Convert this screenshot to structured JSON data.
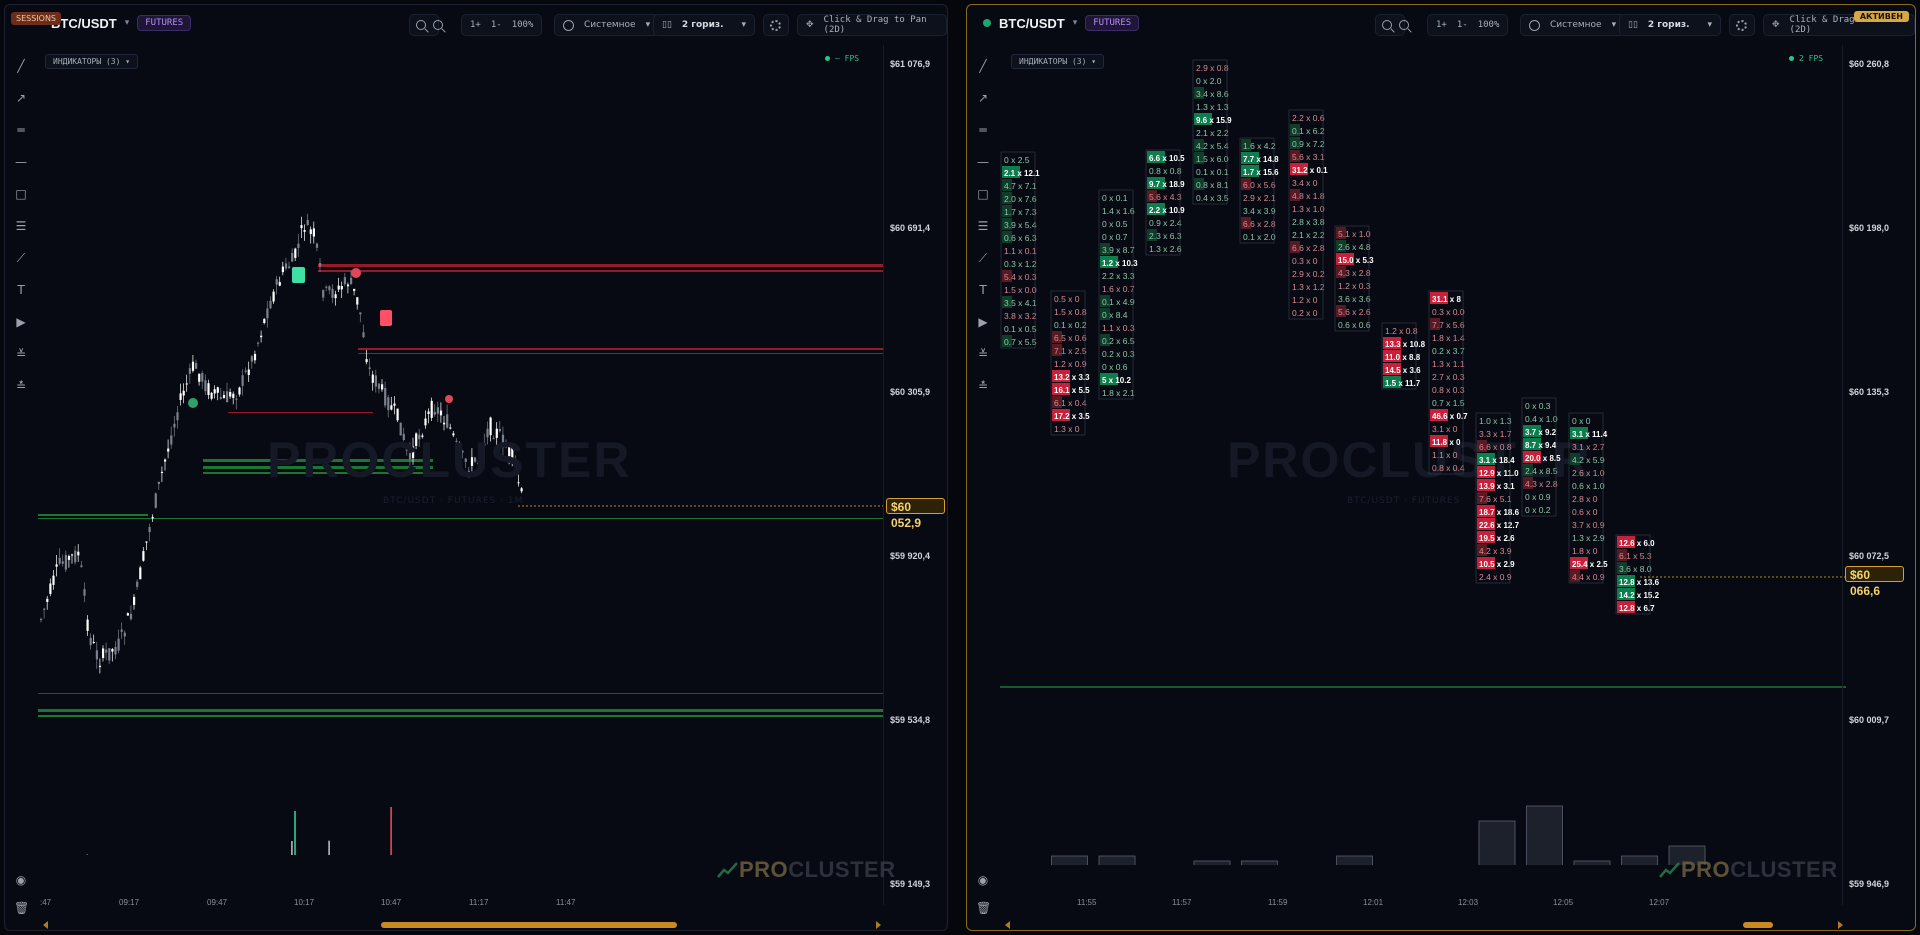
{
  "left_pane": {
    "session_badge": "SESSIONS",
    "symbol": "BTC/USDT",
    "market": "FUTURES",
    "zoom_in_icon": "zoom-in-icon",
    "zoom_out_icon": "zoom-out-icon",
    "step_up": "1+",
    "step_down": "1-",
    "zoom_pct": "100%",
    "timezone": "Системное",
    "layout": "2 гориз.",
    "pan_hint": "Click & Drag to Pan (2D)",
    "indicators": "ИНДИКАТОРЫ (3)",
    "fps": "— FPS",
    "watermark": "PROCLUSTER",
    "watermark_sub": "BTC/USDT · FUTURES · 1M",
    "logo_pro": "PRO",
    "logo_cluster": "CLUSTER",
    "price_labels": [
      "$61 076,9",
      "$60 691,4",
      "$60 305,9",
      "$59 920,4",
      "$59 534,8",
      "$59 149,3"
    ],
    "current_price": "$60 052,9",
    "time_labels": [
      ":47",
      "09:17",
      "09:47",
      "10:17",
      "10:47",
      "11:17",
      "11:47"
    ],
    "colors": {
      "up": "#ffffff",
      "down": "#7b818c",
      "bid_level": "#1f8a3a",
      "ask_level": "#b01e2a",
      "accent": "#d9a12b"
    }
  },
  "right_pane": {
    "active_badge": "АКТИВЕН",
    "symbol": "BTC/USDT",
    "market": "FUTURES",
    "step_up": "1+",
    "step_down": "1-",
    "zoom_pct": "100%",
    "timezone": "Системное",
    "layout": "2 гориз.",
    "pan_hint": "Click & Drag to Pan (2D)",
    "indicators": "ИНДИКАТОРЫ (3)",
    "fps": "2 FPS",
    "watermark": "PROCLUSTER",
    "watermark_sub": "BTC/USDT · FUTURES",
    "logo_pro": "PRO",
    "logo_cluster": "CLUSTER",
    "price_labels": [
      "$60 260,8",
      "$60 198,0",
      "$60 135,3",
      "$60 072,5",
      "$60 009,7",
      "$59 946,9"
    ],
    "current_price": "$60 066,6",
    "time_labels": [
      "11:55",
      "11:57",
      "11:59",
      "12:01",
      "12:03",
      "12:05",
      "12:07"
    ],
    "footprint_columns": [
      {
        "cells": [
          [
            "0",
            "2.5"
          ],
          [
            "2.1",
            "12.1"
          ],
          [
            "4.7",
            "7.1"
          ],
          [
            "2.0",
            "7.6"
          ],
          [
            "1.7",
            "7.3"
          ],
          [
            "3.9",
            "5.4"
          ],
          [
            "0.6",
            "6.3"
          ],
          [
            "1.1",
            "0.1"
          ],
          [
            "0.3",
            "1.2"
          ],
          [
            "5.4",
            "0.3"
          ],
          [
            "1.5",
            "0.0"
          ],
          [
            "3.5",
            "4.1"
          ],
          [
            "3.8",
            "3.2"
          ],
          [
            "0.1",
            "0.5"
          ],
          [
            "0.7",
            "5.5"
          ]
        ]
      },
      {
        "cells": [
          [
            "0.5",
            "0"
          ],
          [
            "1.5",
            "0.8"
          ],
          [
            "0.1",
            "0.2"
          ],
          [
            "6.5",
            "0.6"
          ],
          [
            "7.1",
            "2.5"
          ],
          [
            "1.2",
            "0.9"
          ],
          [
            "13.2",
            "3.3"
          ],
          [
            "16.1",
            "5.5"
          ],
          [
            "6.1",
            "0.4"
          ],
          [
            "17.2",
            "3.5"
          ],
          [
            "1.3",
            "0"
          ]
        ]
      },
      {
        "cells": [
          [
            "0",
            "0.1"
          ],
          [
            "1.4",
            "1.6"
          ],
          [
            "0",
            "0.5"
          ],
          [
            "0",
            "0.7"
          ],
          [
            "3.9",
            "8.7"
          ],
          [
            "1.2",
            "10.3"
          ],
          [
            "2.2",
            "3.3"
          ],
          [
            "1.6",
            "0.7"
          ],
          [
            "0.1",
            "4.9"
          ],
          [
            "0",
            "8.4"
          ],
          [
            "1.1",
            "0.3"
          ],
          [
            "0.2",
            "6.5"
          ],
          [
            "0.2",
            "0.3"
          ],
          [
            "0",
            "0.6"
          ],
          [
            "5",
            "10.2"
          ],
          [
            "1.8",
            "2.1"
          ]
        ]
      },
      {
        "cells": [
          [
            "6.6",
            "10.5"
          ],
          [
            "0.8",
            "0.8"
          ],
          [
            "9.7",
            "18.9"
          ],
          [
            "5.6",
            "4.3"
          ],
          [
            "2.2",
            "10.9"
          ],
          [
            "0.9",
            "2.4"
          ],
          [
            "2.3",
            "6.3"
          ],
          [
            "1.3",
            "2.6"
          ]
        ]
      },
      {
        "cells": [
          [
            "2.9",
            "0.8"
          ],
          [
            "0",
            "2.0"
          ],
          [
            "3.4",
            "8.6"
          ],
          [
            "1.3",
            "1.3"
          ],
          [
            "9.6",
            "15.9"
          ],
          [
            "2.1",
            "2.2"
          ],
          [
            "4.2",
            "5.4"
          ],
          [
            "1.5",
            "6.0"
          ],
          [
            "0.1",
            "0.1"
          ],
          [
            "0.8",
            "8.1"
          ],
          [
            "0.4",
            "3.5"
          ]
        ]
      },
      {
        "cells": [
          [
            "1.6",
            "4.2"
          ],
          [
            "7.7",
            "14.8"
          ],
          [
            "1.7",
            "15.6"
          ],
          [
            "6.0",
            "5.6"
          ],
          [
            "2.9",
            "2.1"
          ],
          [
            "3.4",
            "3.9"
          ],
          [
            "6.6",
            "2.8"
          ],
          [
            "0.1",
            "2.0"
          ]
        ]
      },
      {
        "cells": [
          [
            "2.2",
            "0.6"
          ],
          [
            "0.1",
            "6.2"
          ],
          [
            "0.9",
            "7.2"
          ],
          [
            "5.6",
            "3.1"
          ],
          [
            "31.2",
            "0.1"
          ],
          [
            "3.4",
            "0"
          ],
          [
            "4.8",
            "1.8"
          ],
          [
            "1.3",
            "1.0"
          ],
          [
            "2.8",
            "3.8"
          ],
          [
            "2.1",
            "2.2"
          ],
          [
            "6.6",
            "2.8"
          ],
          [
            "0.3",
            "0"
          ],
          [
            "2.9",
            "0.2"
          ],
          [
            "1.3",
            "1.2"
          ],
          [
            "1.2",
            "0"
          ],
          [
            "0.2",
            "0"
          ]
        ]
      },
      {
        "cells": [
          [
            "5.1",
            "1.0"
          ],
          [
            "2.6",
            "4.8"
          ],
          [
            "15.0",
            "5.3"
          ],
          [
            "4.3",
            "2.8"
          ],
          [
            "1.2",
            "0.3"
          ],
          [
            "3.6",
            "3.6"
          ],
          [
            "5.6",
            "2.6"
          ],
          [
            "0.6",
            "0.6"
          ]
        ]
      },
      {
        "cells": [
          [
            "1.2",
            "0.8"
          ],
          [
            "13.3",
            "10.8"
          ],
          [
            "11.0",
            "8.8"
          ],
          [
            "14.5",
            "3.6"
          ],
          [
            "1.5",
            "11.7"
          ]
        ]
      },
      {
        "cells": [
          [
            "31.1",
            "8"
          ],
          [
            "0.3",
            "0.0"
          ],
          [
            "7.7",
            "5.6"
          ],
          [
            "1.8",
            "1.4"
          ],
          [
            "0.2",
            "3.7"
          ],
          [
            "1.3",
            "1.1"
          ],
          [
            "2.7",
            "0.3"
          ],
          [
            "0.8",
            "0.3"
          ],
          [
            "0.7",
            "1.5"
          ],
          [
            "46.6",
            "0.7"
          ],
          [
            "3.1",
            "0"
          ],
          [
            "11.8",
            "0"
          ],
          [
            "1.1",
            "0"
          ],
          [
            "0.8",
            "0.4"
          ]
        ]
      },
      {
        "cells": [
          [
            "1.0",
            "1.3"
          ],
          [
            "3.3",
            "1.7"
          ],
          [
            "6.6",
            "0.8"
          ],
          [
            "3.1",
            "18.4"
          ],
          [
            "12.9",
            "11.0"
          ],
          [
            "13.9",
            "3.1"
          ],
          [
            "7.6",
            "5.1"
          ],
          [
            "18.7",
            "18.6"
          ],
          [
            "22.6",
            "12.7"
          ],
          [
            "19.5",
            "2.6"
          ],
          [
            "4.2",
            "3.9"
          ],
          [
            "10.5",
            "2.9"
          ],
          [
            "2.4",
            "0.9"
          ]
        ]
      },
      {
        "cells": [
          [
            "0",
            "0.3"
          ],
          [
            "0.4",
            "1.0"
          ],
          [
            "3.7",
            "9.2"
          ],
          [
            "8.7",
            "9.4"
          ],
          [
            "20.0",
            "8.5"
          ],
          [
            "2.4",
            "8.5"
          ],
          [
            "4.3",
            "2.8"
          ],
          [
            "0",
            "0.9"
          ],
          [
            "0",
            "0.2"
          ]
        ]
      },
      {
        "cells": [
          [
            "0",
            "0"
          ],
          [
            "3.1",
            "11.4"
          ],
          [
            "3.1",
            "2.7"
          ],
          [
            "4.2",
            "5.9"
          ],
          [
            "2.6",
            "1.0"
          ],
          [
            "0.6",
            "1.0"
          ],
          [
            "2.8",
            "0"
          ],
          [
            "0.6",
            "0"
          ],
          [
            "3.7",
            "0.9"
          ],
          [
            "1.3",
            "2.9"
          ],
          [
            "1.8",
            "0"
          ],
          [
            "25.4",
            "2.5"
          ],
          [
            "4.4",
            "0.9"
          ]
        ]
      },
      {
        "cells": [
          [
            "12.6",
            "6.0"
          ],
          [
            "6.1",
            "5.3"
          ],
          [
            "3.6",
            "8.0"
          ],
          [
            "12.8",
            "13.6"
          ],
          [
            "14.2",
            "15.2"
          ],
          [
            "12.8",
            "6.7"
          ]
        ]
      }
    ],
    "volume_bars": [
      4,
      7,
      7,
      5,
      6,
      6,
      5,
      7,
      5,
      5,
      14,
      17,
      6,
      7,
      9
    ]
  }
}
